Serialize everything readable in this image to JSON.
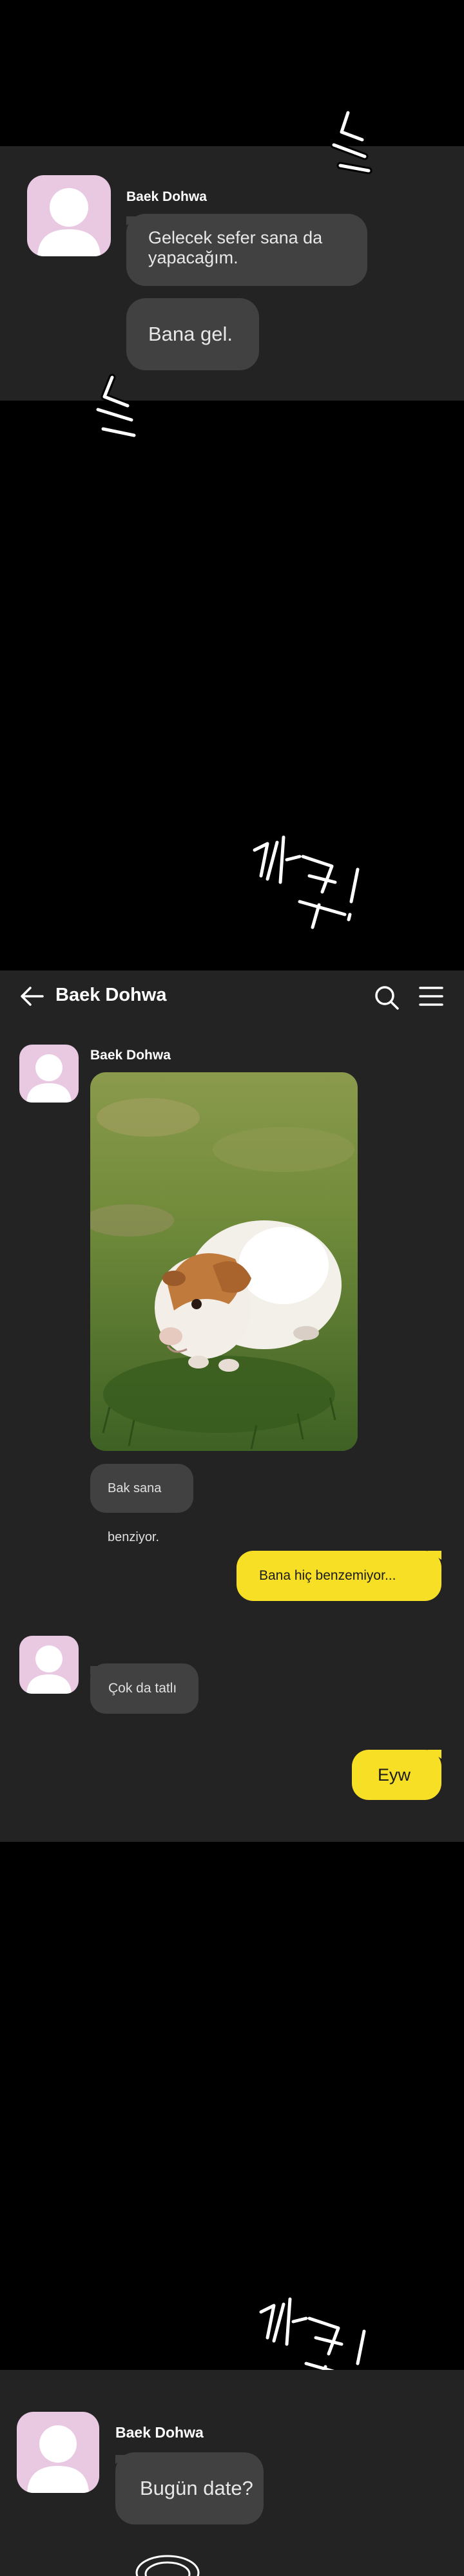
{
  "panel1": {
    "contact_name": "Baek Dohwa",
    "messages": [
      "Gelecek sefer sana da yapacağım.",
      "Bana gel."
    ]
  },
  "chat": {
    "header": {
      "back_icon": "arrow-left-icon",
      "title": "Baek Dohwa",
      "search_icon": "search-icon",
      "menu_icon": "hamburger-menu-icon"
    },
    "contact_name": "Baek Dohwa",
    "photo_caption": "Bak sana benziyor.",
    "outgoing_1": "Bana hiç benzemiyor...",
    "incoming_2": "Çok da tatlı",
    "outgoing_2": "Eyw"
  },
  "panel3": {
    "contact_name": "Baek Dohwa",
    "message": "Bugün date?"
  },
  "colors": {
    "panel_bg": "#232323",
    "page_bg": "#000000",
    "incoming_bubble": "#414141",
    "outgoing_bubble": "#f7df26",
    "avatar_bg": "#e9c8e2"
  }
}
